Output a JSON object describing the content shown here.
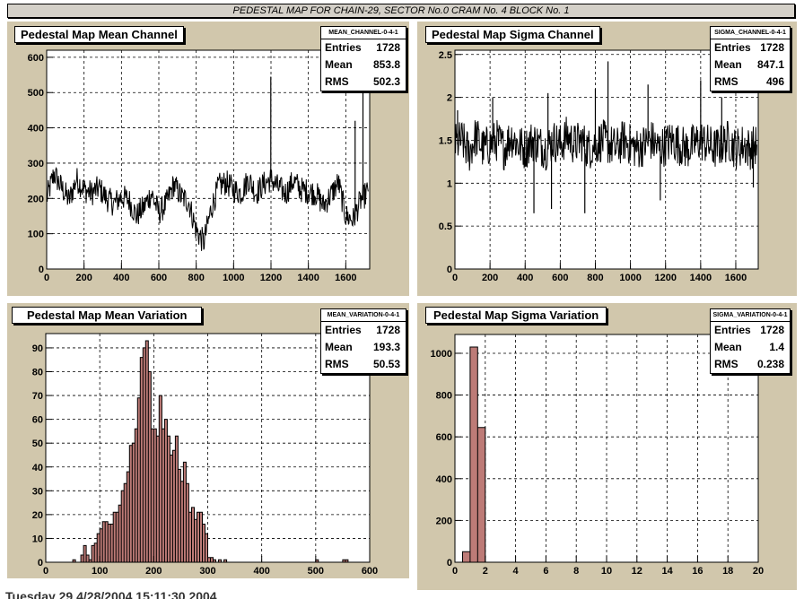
{
  "page_title": "PEDESTAL MAP FOR CHAIN-29, SECTOR No.0 CRAM No. 4 BLOCK No. 1",
  "footer_text": "Tuesday 29 4/28/2004 15:11:30 2004",
  "panels": [
    {
      "title": "Pedestal Map Mean Channel",
      "stats": {
        "name": "MEAN_CHANNEL-0-4-1",
        "rows": [
          {
            "label": "Entries",
            "value": "1728"
          },
          {
            "label": "Mean",
            "value": "853.8"
          },
          {
            "label": "RMS",
            "value": "502.3"
          }
        ]
      }
    },
    {
      "title": "Pedestal Map Sigma Channel",
      "stats": {
        "name": "SIGMA_CHANNEL-0-4-1",
        "rows": [
          {
            "label": "Entries",
            "value": "1728"
          },
          {
            "label": "Mean",
            "value": "847.1"
          },
          {
            "label": "RMS",
            "value": "496"
          }
        ]
      }
    },
    {
      "title": "Pedestal Map Mean Variation",
      "stats": {
        "name": "MEAN_VARIATION-0-4-1",
        "rows": [
          {
            "label": "Entries",
            "value": "1728"
          },
          {
            "label": "Mean",
            "value": "193.3"
          },
          {
            "label": "RMS",
            "value": "50.53"
          }
        ]
      }
    },
    {
      "title": "Pedestal Map Sigma Variation",
      "stats": {
        "name": "SIGMA_VARIATION-0-4-1",
        "rows": [
          {
            "label": "Entries",
            "value": "1728"
          },
          {
            "label": "Mean",
            "value": "1.4"
          },
          {
            "label": "RMS",
            "value": "0.238"
          }
        ]
      }
    }
  ],
  "chart_data": [
    {
      "type": "line",
      "title": "Pedestal Map Mean Channel",
      "xlim": [
        0,
        1728
      ],
      "ylim": [
        0,
        620
      ],
      "xticks": [
        0,
        200,
        400,
        600,
        800,
        1000,
        1200,
        1400,
        1600
      ],
      "yticks": [
        0,
        100,
        200,
        300,
        400,
        500,
        600
      ],
      "grid": true,
      "x": [
        0,
        40,
        80,
        120,
        160,
        200,
        240,
        280,
        320,
        360,
        400,
        440,
        480,
        520,
        560,
        600,
        640,
        680,
        720,
        760,
        800,
        840,
        880,
        920,
        960,
        1000,
        1040,
        1080,
        1120,
        1160,
        1200,
        1240,
        1280,
        1320,
        1360,
        1400,
        1440,
        1480,
        1520,
        1560,
        1600,
        1640,
        1680,
        1720
      ],
      "y": [
        200,
        270,
        230,
        195,
        255,
        225,
        215,
        230,
        200,
        185,
        205,
        195,
        150,
        175,
        215,
        160,
        185,
        240,
        205,
        190,
        110,
        75,
        170,
        235,
        245,
        225,
        215,
        255,
        215,
        240,
        255,
        230,
        215,
        250,
        225,
        220,
        215,
        180,
        210,
        245,
        150,
        140,
        195,
        220
      ],
      "spikes": [
        {
          "x": 1199,
          "y": 545
        },
        {
          "x": 1650,
          "y": 420
        },
        {
          "x": 1692,
          "y": 620
        }
      ],
      "line_color": "#000000"
    },
    {
      "type": "line",
      "title": "Pedestal Map Sigma Channel",
      "xlim": [
        0,
        1728
      ],
      "ylim": [
        0,
        2.55
      ],
      "xticks": [
        0,
        200,
        400,
        600,
        800,
        1000,
        1200,
        1400,
        1600
      ],
      "yticks": [
        0,
        0.5,
        1,
        1.5,
        2,
        2.5
      ],
      "grid": true,
      "x": [
        0,
        40,
        80,
        120,
        160,
        200,
        240,
        280,
        320,
        360,
        400,
        440,
        480,
        520,
        560,
        600,
        640,
        680,
        720,
        760,
        800,
        840,
        880,
        920,
        960,
        1000,
        1040,
        1080,
        1120,
        1160,
        1200,
        1240,
        1280,
        1320,
        1360,
        1400,
        1440,
        1480,
        1520,
        1560,
        1600,
        1640,
        1680,
        1720
      ],
      "y": [
        1.45,
        1.5,
        1.35,
        1.55,
        1.4,
        1.45,
        1.5,
        1.4,
        1.55,
        1.45,
        1.4,
        1.5,
        1.45,
        1.4,
        1.5,
        1.45,
        1.55,
        1.45,
        1.5,
        1.4,
        1.45,
        1.5,
        1.45,
        1.4,
        1.5,
        1.45,
        1.4,
        1.45,
        1.5,
        1.4,
        1.45,
        1.5,
        1.45,
        1.4,
        1.45,
        1.5,
        1.45,
        1.4,
        1.45,
        1.5,
        1.4,
        1.45,
        1.4,
        1.45
      ],
      "spread": 0.25,
      "spikes": [
        {
          "x": 15,
          "y": 1.85
        },
        {
          "x": 215,
          "y": 2.0
        },
        {
          "x": 450,
          "y": 0.65
        },
        {
          "x": 530,
          "y": 2.05
        },
        {
          "x": 550,
          "y": 0.7
        },
        {
          "x": 740,
          "y": 0.65
        },
        {
          "x": 800,
          "y": 2.1
        },
        {
          "x": 872,
          "y": 2.42
        },
        {
          "x": 1100,
          "y": 2.15
        },
        {
          "x": 1170,
          "y": 0.8
        },
        {
          "x": 1400,
          "y": 2.2
        },
        {
          "x": 1520,
          "y": 2.0
        },
        {
          "x": 1700,
          "y": 0.95
        }
      ],
      "line_color": "#000000"
    },
    {
      "type": "bar",
      "title": "Pedestal Map Mean Variation",
      "xlim": [
        0,
        600
      ],
      "ylim": [
        0,
        96
      ],
      "xticks": [
        0,
        100,
        200,
        300,
        400,
        500,
        600
      ],
      "yticks": [
        0,
        10,
        20,
        30,
        40,
        50,
        60,
        70,
        80,
        90
      ],
      "grid": true,
      "bin_width": 5,
      "bins_start": [
        50,
        55,
        60,
        65,
        70,
        75,
        80,
        85,
        90,
        95,
        100,
        105,
        110,
        115,
        120,
        125,
        130,
        135,
        140,
        145,
        150,
        155,
        160,
        165,
        170,
        175,
        180,
        185,
        190,
        195,
        200,
        205,
        210,
        215,
        220,
        225,
        230,
        235,
        240,
        245,
        250,
        255,
        260,
        265,
        270,
        275,
        280,
        285,
        290,
        295,
        300,
        305,
        310,
        320,
        330,
        500,
        550,
        555
      ],
      "values": [
        1,
        0,
        0,
        3,
        7,
        3,
        1,
        7,
        8,
        12,
        14,
        17,
        17,
        16,
        16,
        21,
        21,
        24,
        30,
        33,
        38,
        49,
        50,
        56,
        69,
        86,
        90,
        93,
        80,
        56,
        56,
        53,
        70,
        56,
        60,
        53,
        45,
        47,
        53,
        39,
        34,
        42,
        33,
        21,
        23,
        18,
        21,
        21,
        16,
        12,
        2,
        2,
        1,
        1,
        1,
        1,
        1,
        1
      ],
      "fill_color": "#bd7b77"
    },
    {
      "type": "bar",
      "title": "Pedestal Map Sigma Variation",
      "xlim": [
        0,
        20
      ],
      "ylim": [
        0,
        1090
      ],
      "xticks": [
        0,
        2,
        4,
        6,
        8,
        10,
        12,
        14,
        16,
        18,
        20
      ],
      "yticks": [
        0,
        200,
        400,
        600,
        800,
        1000
      ],
      "grid": true,
      "bin_width": 0.5,
      "bins_start": [
        0.5,
        1.0,
        1.5
      ],
      "values": [
        50,
        1030,
        645
      ],
      "fill_color": "#bd7b77"
    }
  ]
}
